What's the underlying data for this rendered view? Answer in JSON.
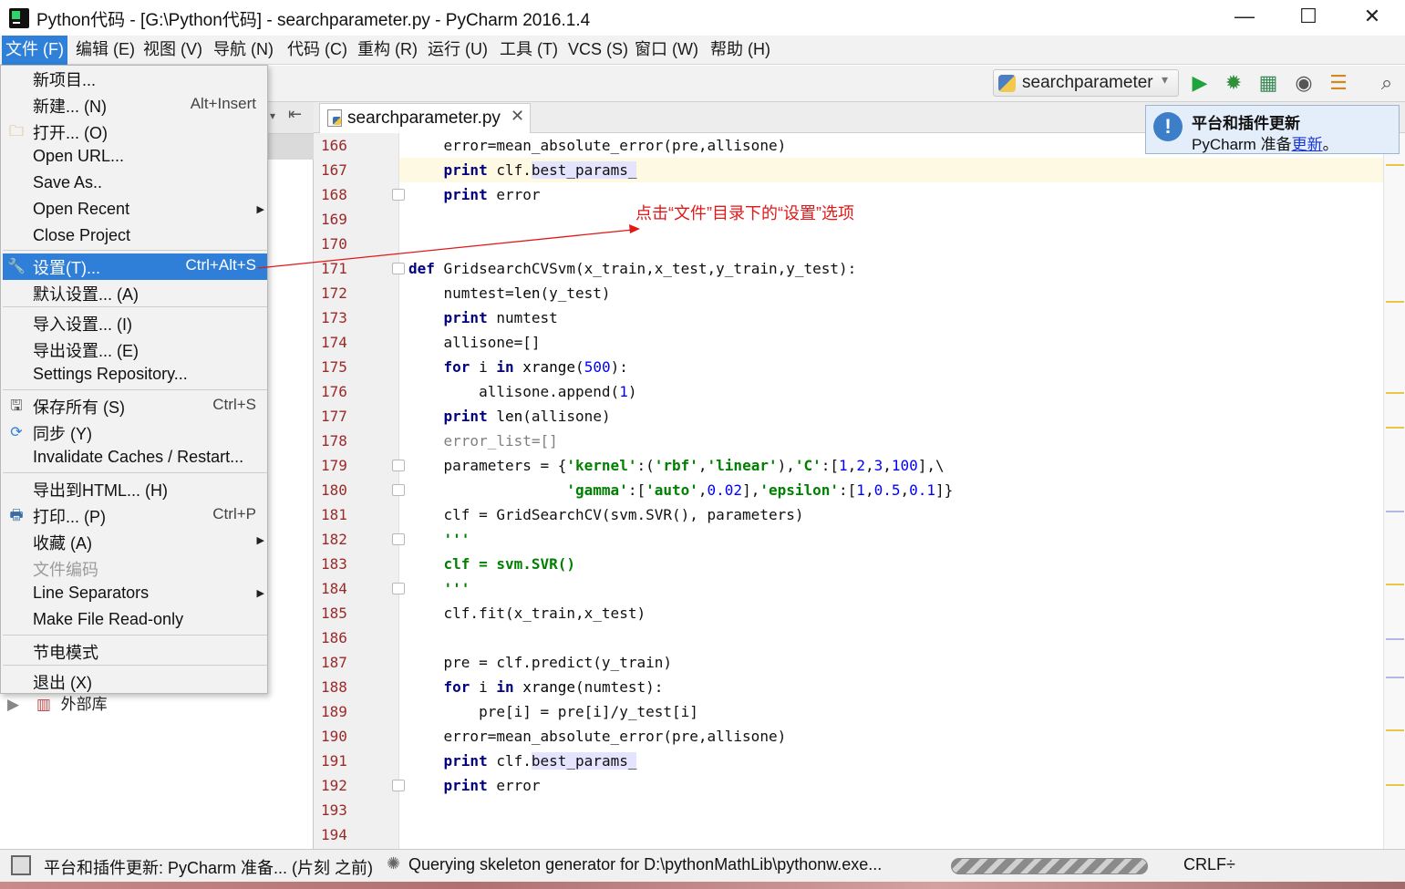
{
  "window": {
    "title": "Python代码 - [G:\\Python代码] - searchparameter.py - PyCharm 2016.1.4",
    "controls": [
      "—",
      "☐",
      "✕"
    ]
  },
  "menubar": [
    "文件 (F)",
    "编辑 (E)",
    "视图 (V)",
    "导航 (N)",
    "代码 (C)",
    "重构 (R)",
    "运行 (U)",
    "工具 (T)",
    "VCS (S)",
    "窗口 (W)",
    "帮助 (H)"
  ],
  "toolbar": {
    "run_config": "searchparameter"
  },
  "editor": {
    "tab_label": "searchparameter.py",
    "lines": [
      {
        "n": "166",
        "t": "    error=mean_absolute_error(pre,allisone)"
      },
      {
        "n": "167",
        "t": "    print clf.best_params_"
      },
      {
        "n": "168",
        "t": "    print error"
      },
      {
        "n": "169",
        "t": ""
      },
      {
        "n": "170",
        "t": ""
      },
      {
        "n": "171",
        "t": "def GridsearchCVSvm(x_train,x_test,y_train,y_test):"
      },
      {
        "n": "172",
        "t": "    numtest=len(y_test)"
      },
      {
        "n": "173",
        "t": "    print numtest"
      },
      {
        "n": "174",
        "t": "    allisone=[]"
      },
      {
        "n": "175",
        "t": "    for i in xrange(500):"
      },
      {
        "n": "176",
        "t": "        allisone.append(1)"
      },
      {
        "n": "177",
        "t": "    print len(allisone)"
      },
      {
        "n": "178",
        "t": "    error_list=[]"
      },
      {
        "n": "179",
        "t": "    parameters = {'kernel':('rbf','linear'),'C':[1,2,3,100],\\"
      },
      {
        "n": "180",
        "t": "                  'gamma':['auto',0.02],'epsilon':[1,0.5,0.1]}"
      },
      {
        "n": "181",
        "t": "    clf = GridSearchCV(svm.SVR(), parameters)"
      },
      {
        "n": "182",
        "t": "    '''"
      },
      {
        "n": "183",
        "t": "    clf = svm.SVR()"
      },
      {
        "n": "184",
        "t": "    '''"
      },
      {
        "n": "185",
        "t": "    clf.fit(x_train,x_test)"
      },
      {
        "n": "186",
        "t": ""
      },
      {
        "n": "187",
        "t": "    pre = clf.predict(y_train)"
      },
      {
        "n": "188",
        "t": "    for i in xrange(numtest):"
      },
      {
        "n": "189",
        "t": "        pre[i] = pre[i]/y_test[i]"
      },
      {
        "n": "190",
        "t": "    error=mean_absolute_error(pre,allisone)"
      },
      {
        "n": "191",
        "t": "    print clf.best_params_"
      },
      {
        "n": "192",
        "t": "    print error"
      },
      {
        "n": "193",
        "t": ""
      },
      {
        "n": "194",
        "t": ""
      }
    ]
  },
  "notification": {
    "title": "平台和插件更新",
    "body_prefix": "PyCharm 准备",
    "link": "更新",
    "body_suffix": "。"
  },
  "file_menu": [
    {
      "label": "新项目...",
      "shortcut": "",
      "icon": ""
    },
    {
      "label": "新建... (N)",
      "shortcut": "Alt+Insert",
      "icon": ""
    },
    {
      "label": "打开... (O)",
      "shortcut": "",
      "icon": "folder-icon"
    },
    {
      "label": "Open URL...",
      "shortcut": "",
      "icon": ""
    },
    {
      "label": "Save As..",
      "shortcut": "",
      "icon": ""
    },
    {
      "label": "Open Recent",
      "shortcut": "",
      "icon": "",
      "submenu": true
    },
    {
      "label": "Close Project",
      "shortcut": "",
      "icon": ""
    },
    {
      "label": "设置(T)...",
      "shortcut": "Ctrl+Alt+S",
      "icon": "wrench-icon",
      "selected": true
    },
    {
      "label": "默认设置... (A)",
      "shortcut": "",
      "icon": ""
    },
    {
      "label": "导入设置... (I)",
      "shortcut": "",
      "icon": ""
    },
    {
      "label": "导出设置... (E)",
      "shortcut": "",
      "icon": ""
    },
    {
      "label": "Settings Repository...",
      "shortcut": "",
      "icon": ""
    },
    {
      "label": "保存所有 (S)",
      "shortcut": "Ctrl+S",
      "icon": "save-icon"
    },
    {
      "label": "同步 (Y)",
      "shortcut": "",
      "icon": "sync-icon"
    },
    {
      "label": "Invalidate Caches / Restart...",
      "shortcut": "",
      "icon": ""
    },
    {
      "label": "导出到HTML... (H)",
      "shortcut": "",
      "icon": ""
    },
    {
      "label": "打印... (P)",
      "shortcut": "Ctrl+P",
      "icon": "print-icon"
    },
    {
      "label": "收藏 (A)",
      "shortcut": "",
      "icon": "",
      "submenu": true
    },
    {
      "label": "文件编码",
      "shortcut": "",
      "icon": "",
      "disabled": true
    },
    {
      "label": "Line Separators",
      "shortcut": "",
      "icon": "",
      "submenu": true
    },
    {
      "label": "Make File Read-only",
      "shortcut": "",
      "icon": ""
    },
    {
      "label": "节电模式",
      "shortcut": "",
      "icon": ""
    },
    {
      "label": "退出 (X)",
      "shortcut": "",
      "icon": ""
    }
  ],
  "project_tree": {
    "external_libs": "外部库"
  },
  "annotation": "点击“文件”目录下的“设置”选项",
  "statusbar": {
    "message": "平台和插件更新: PyCharm 准备... (片刻 之前)",
    "task": "Querying skeleton generator for D:\\pythonMathLib\\pythonw.exe...",
    "line_sep": "CRLF÷"
  },
  "colors": {
    "accent": "#2f7fd9",
    "annotation": "#e01818",
    "keyword": "#000080",
    "number": "#0000ff",
    "string": "#008000"
  }
}
